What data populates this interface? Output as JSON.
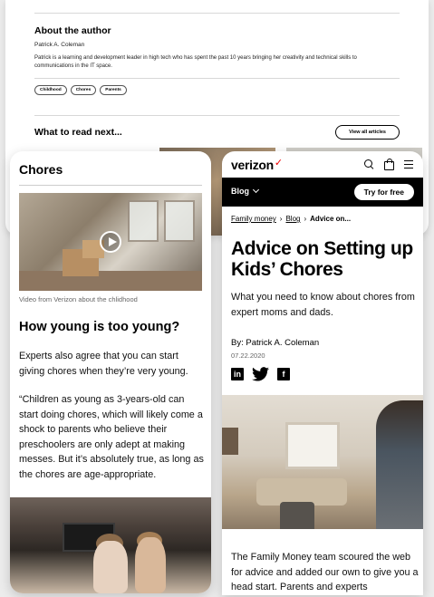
{
  "desktop": {
    "about_heading": "About the author",
    "author_name": "Patrick A. Coleman",
    "author_bio": "Patrick is a learning and development leader in high tech who has spent the past 10 years bringing her creativity and technical skills to communications in the IT space.",
    "tags": [
      "Childhood",
      "Chores",
      "Parents"
    ],
    "read_next_heading": "What to read next...",
    "view_all_label": "View all articles"
  },
  "left_phone": {
    "title": "Chores",
    "video_caption": "Video from Verizon about the chlidhood",
    "heading": "How young is too young?",
    "para1": "Experts also agree that you can start giving chores when they’re very young.",
    "para2": "“Children as young as 3-years-old can start doing chores, which will likely come a shock to parents who believe their preschoolers are only adept at making messes. But it’s absolutely true, as long as the chores are age-appropriate."
  },
  "right_phone": {
    "logo": "verizon",
    "logo_check": "✓",
    "blog_label": "Blog",
    "try_label": "Try for free",
    "breadcrumb": [
      "Family money",
      "Blog",
      "Advice on..."
    ],
    "title": "Advice on Setting up Kids’ Chores",
    "subtitle": "What you need to know about chores from expert moms and dads.",
    "byline": "By: Patrick A. Coleman",
    "date": "07.22.2020",
    "social": {
      "linkedin": "in",
      "facebook": "f"
    },
    "body": "The Family Money team scoured the web for advice and added our own to give you a head start. Parents and experts"
  },
  "colors": {
    "brand_red": "#ee0000",
    "black": "#000000",
    "caption_gray": "#666666"
  }
}
